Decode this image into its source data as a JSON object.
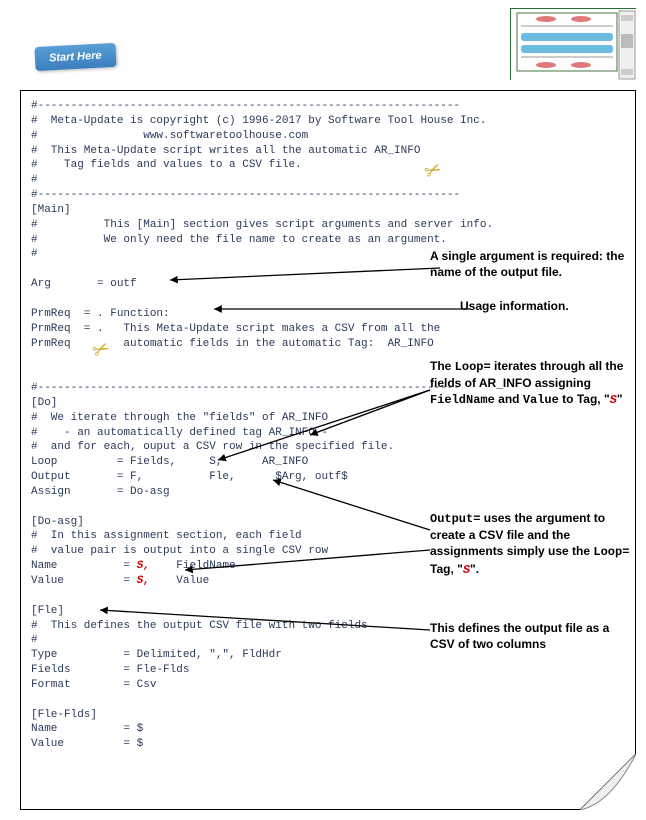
{
  "start_button": "Start Here",
  "code": {
    "lines": [
      "#----------------------------------------------------------------",
      "#  Meta-Update is copyright (c) 1996-2017 by Software Tool House Inc.",
      "#                www.softwaretoolhouse.com",
      "#  This Meta-Update script writes all the automatic AR_INFO",
      "#    Tag fields and values to a CSV file.",
      "#",
      "#----------------------------------------------------------------",
      "[Main]",
      "#          This [Main] section gives script arguments and server info.",
      "#          We only need the file name to create as an argument.",
      "#",
      "",
      "Arg       = outf",
      "",
      "PrmReq  = . Function:",
      "PrmReq  = .   This Meta-Update script makes a CSV from all the",
      "PrmReq        automatic fields in the automatic Tag:  AR_INFO",
      "",
      "",
      "#----------------------------------------------------------------",
      "[Do]",
      "#  We iterate through the \"fields\" of AR_INFO",
      "#    - an automatically defined tag AR_INFO -",
      "#  and for each, ouput a CSV row in the specified file.",
      "Loop         = Fields,     S,      AR_INFO",
      "Output       = F,          Fle,      $Arg, outf$",
      "Assign       = Do-asg",
      "",
      "[Do-asg]",
      "#  In this assignment section, each field",
      "#  value pair is output into a single CSV row"
    ],
    "name_line_prefix": "Name          = ",
    "name_line_mid1": "S",
    "name_line_mid2": ",",
    "name_line_suffix": "    FieldName",
    "value_line_prefix": "Value         = ",
    "value_line_mid1": "S",
    "value_line_mid2": ",",
    "value_line_suffix": "    Value",
    "tail_lines": [
      "",
      "[Fle]",
      "#  This defines the output CSV file with two fields",
      "#",
      "Type          = Delimited, \",\", FldHdr",
      "Fields        = Fle-Flds",
      "Format        = Csv",
      "",
      "[Fle-Flds]",
      "Name          = $",
      "Value         = $"
    ]
  },
  "annotations": {
    "a1": "A single argument is required: the name of the output file.",
    "a2": "Usage information.",
    "a3_p1": "The ",
    "a3_loop": "Loop=",
    "a3_p2": " iterates through all the fields of AR_INFO assigning ",
    "a3_fn": "FieldName",
    "a3_p3": " and ",
    "a3_val": "Value",
    "a3_p4": " to Tag, \"",
    "a3_s": "S",
    "a3_p5": "\"",
    "a4_p1": "",
    "a4_out": "Output=",
    "a4_p2": " uses the argument to create a CSV file and the assignments simply use the ",
    "a4_loop": "Loop=",
    "a4_p3": " Tag, \"",
    "a4_s": "S",
    "a4_p4": "\".",
    "a5": "This defines the output file as a CSV of two columns"
  }
}
